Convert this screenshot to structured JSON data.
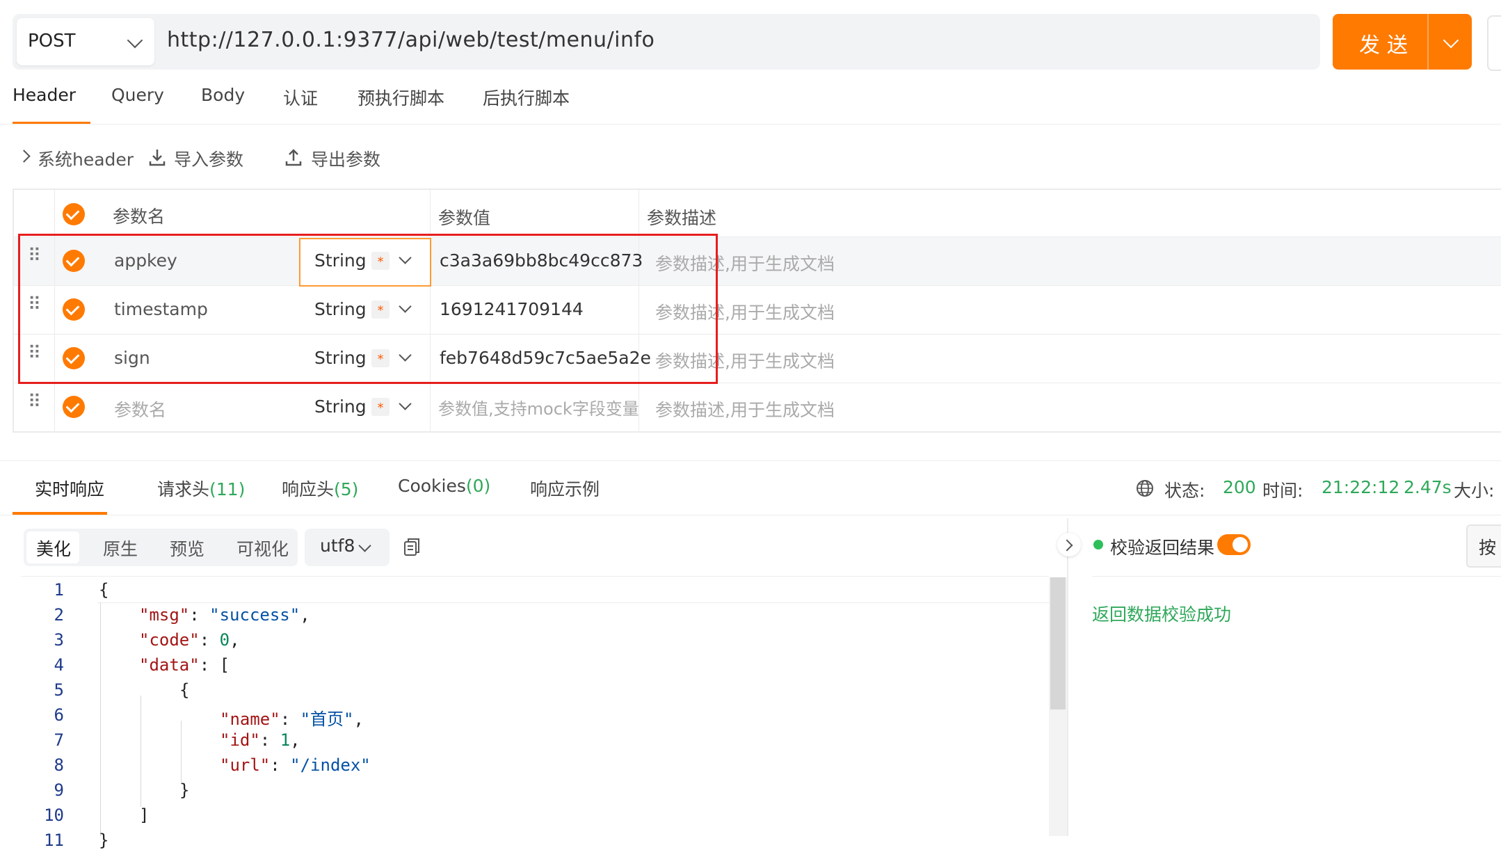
{
  "request": {
    "method": "POST",
    "url": "http://127.0.0.1:9377/api/web/test/menu/info",
    "send_label": "发送"
  },
  "tabs": [
    {
      "label": "Header",
      "active": true
    },
    {
      "label": "Query"
    },
    {
      "label": "Body"
    },
    {
      "label": "认证"
    },
    {
      "label": "预执行脚本"
    },
    {
      "label": "后执行脚本"
    }
  ],
  "toolbar": {
    "system_header": "系统header",
    "import": "导入参数",
    "export": "导出参数"
  },
  "param_table": {
    "headers": {
      "name": "参数名",
      "value": "参数值",
      "desc": "参数描述"
    },
    "rows": [
      {
        "name": "appkey",
        "type": "String",
        "required": "*",
        "value": "c3a3a69bb8bc49cc873",
        "desc": "参数描述,用于生成文档"
      },
      {
        "name": "timestamp",
        "type": "String",
        "required": "*",
        "value": "1691241709144",
        "desc": "参数描述,用于生成文档"
      },
      {
        "name": "sign",
        "type": "String",
        "required": "*",
        "value": "feb7648d59c7c5ae5a2e",
        "desc": "参数描述,用于生成文档"
      }
    ],
    "new_row": {
      "name_placeholder": "参数名",
      "type": "String",
      "required": "*",
      "value_placeholder": "参数值,支持mock字段变量",
      "desc_placeholder": "参数描述,用于生成文档"
    }
  },
  "response": {
    "tabs": {
      "realtime": "实时响应",
      "req_headers": "请求头",
      "req_headers_count": "(11)",
      "resp_headers": "响应头",
      "resp_headers_count": "(5)",
      "cookies": "Cookies",
      "cookies_count": "(0)",
      "example": "响应示例"
    },
    "status_label": "状态:",
    "status_value": "200",
    "time_label": "时间:",
    "time_value": "21:22:12",
    "duration": "2.47s",
    "size_label": "大小:",
    "formats": [
      "美化",
      "原生",
      "预览",
      "可视化"
    ],
    "encoding": "utf8",
    "code_lines": [
      "1",
      "2",
      "3",
      "4",
      "5",
      "6",
      "7",
      "8",
      "9",
      "10",
      "11"
    ],
    "json": {
      "msg_key": "\"msg\"",
      "msg_val": "\"success\"",
      "code_key": "\"code\"",
      "code_val": "0",
      "data_key": "\"data\"",
      "name_key": "\"name\"",
      "name_val": "\"首页\"",
      "id_key": "\"id\"",
      "id_val": "1",
      "url_key": "\"url\"",
      "url_val": "\"/index\""
    },
    "validation_label": "校验返回结果",
    "validation_result": "返回数据校验成功",
    "side_button": "按"
  },
  "colors": {
    "accent": "#ff7a00",
    "success": "#2fa85a",
    "highlight_box": "#e61e1e"
  }
}
